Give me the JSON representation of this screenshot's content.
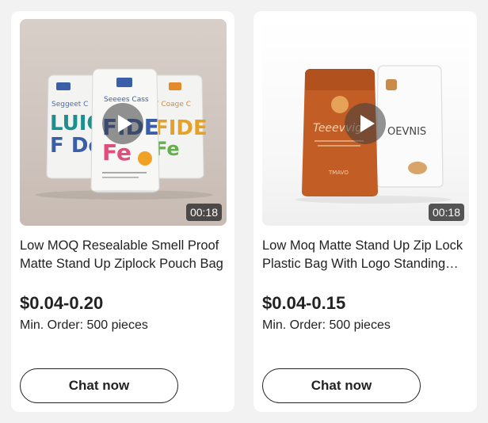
{
  "products": [
    {
      "duration": "00:18",
      "title": "Low MOQ Resealable Smell Proof Matte Stand Up Ziplock Pouch Bag",
      "price": "$0.04-0.20",
      "min_order": "Min. Order: 500 pieces",
      "cta": "Chat now",
      "image": "pouches-labeled-food-video-thumbnail"
    },
    {
      "duration": "00:18",
      "title": "Low Moq Matte Stand Up Zip Lock Plastic Bag With Logo Standing Pouch",
      "price": "$0.04-0.15",
      "min_order": "Min. Order: 500 pieces",
      "cta": "Chat now",
      "image": "orange-and-white-pouches-video-thumbnail"
    }
  ],
  "colors": {
    "page_bg": "#f2f2f2",
    "card_bg": "#ffffff",
    "text": "#222222"
  }
}
